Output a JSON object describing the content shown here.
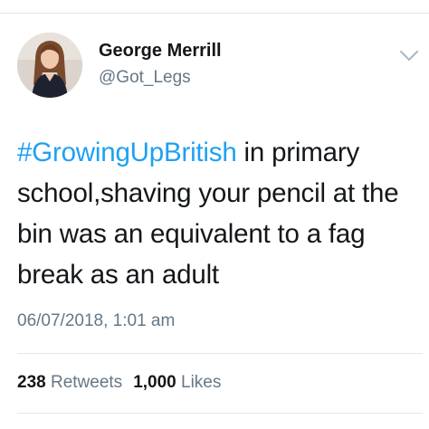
{
  "user": {
    "display_name": "George Merrill",
    "handle": "@Got_Legs"
  },
  "tweet": {
    "hashtag": "#GrowingUpBritish",
    "text": " in primary school,shaving your pencil at the bin was an equivalent to a fag break as an adult",
    "timestamp": "06/07/2018, 1:01 am"
  },
  "stats": {
    "retweets_count": "238",
    "retweets_label": "Retweets",
    "likes_count": "1,000",
    "likes_label": "Likes"
  },
  "icons": {
    "menu": "chevron-down-icon",
    "avatar": "profile-photo"
  },
  "colors": {
    "link": "#1da1f2",
    "text": "#14171a",
    "secondary": "#657786",
    "divider": "#e1e8ed"
  }
}
